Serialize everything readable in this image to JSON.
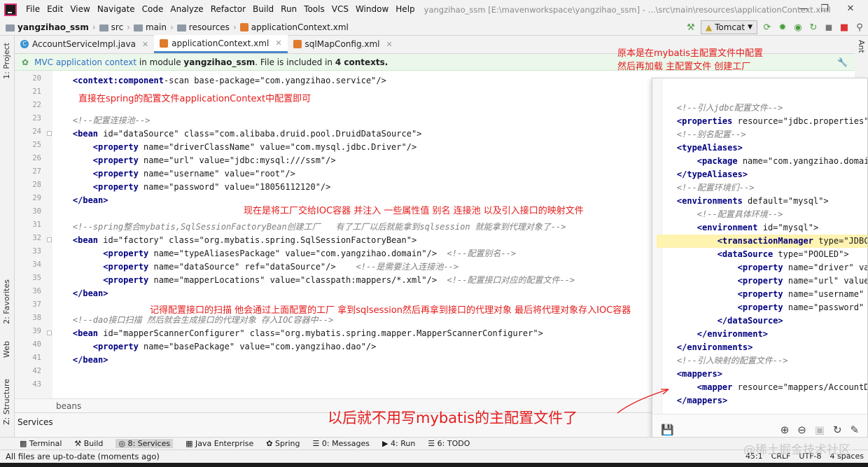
{
  "menubar": {
    "items": [
      "File",
      "Edit",
      "View",
      "Navigate",
      "Code",
      "Analyze",
      "Refactor",
      "Build",
      "Run",
      "Tools",
      "VCS",
      "Window",
      "Help"
    ],
    "title": "yangzihao_ssm [E:\\mavenworkspace\\yangzihao_ssm] - ...\\src\\main\\resources\\applicationContext.xml"
  },
  "breadcrumb": [
    "yangzihao_ssm",
    "src",
    "main",
    "resources",
    "applicationContext.xml"
  ],
  "toolbar": {
    "run_config": "Tomcat"
  },
  "tabs": [
    {
      "label": "AccountServiceImpl.java",
      "type": "java"
    },
    {
      "label": "applicationContext.xml",
      "type": "xml"
    },
    {
      "label": "sqlMapConfig.xml",
      "type": "xml"
    }
  ],
  "banner": {
    "link": "MVC application context",
    "text1": " in module ",
    "module": "yangzihao_ssm",
    "text2": ". File is included in ",
    "contexts": "4 contexts."
  },
  "side_tabs": {
    "project": "1: Project",
    "favorites": "2: Favorites",
    "web": "Web",
    "structure": "Z: Structure",
    "ant": "Ant"
  },
  "line_numbers": [
    "20",
    "21",
    "22",
    "23",
    "24",
    "25",
    "26",
    "27",
    "28",
    "29",
    "30",
    "31",
    "32",
    "33",
    "34",
    "35",
    "36",
    "37",
    "38",
    "39",
    "40",
    "41",
    "42",
    "43"
  ],
  "code_lines": [
    "    <context:component-scan base-package=\"com.yangzihao.service\"/>",
    "",
    "",
    "    <!--配置连接池-->",
    "    <bean id=\"dataSource\" class=\"com.alibaba.druid.pool.DruidDataSource\">",
    "        <property name=\"driverClassName\" value=\"com.mysql.jdbc.Driver\"/>",
    "        <property name=\"url\" value=\"jdbc:mysql:///ssm\"/>",
    "        <property name=\"username\" value=\"root\"/>",
    "        <property name=\"password\" value=\"18056112120\"/>",
    "    </bean>",
    "",
    "    <!--spring整合mybatis,SqlSessionFactoryBean创建工厂   有了工厂以后就能拿到sqlsession 就能拿到代理对象了-->",
    "    <bean id=\"factory\" class=\"org.mybatis.spring.SqlSessionFactoryBean\">",
    "          <property name=\"typeAliasesPackage\" value=\"com.yangzihao.domain\"/>  <!--配置别名-->",
    "          <property name=\"dataSource\" ref=\"dataSource\"/>    <!--是需要注入连接池-->",
    "          <property name=\"mapperLocations\" value=\"classpath:mappers/*.xml\"/>  <!--配置接口对应的配置文件-->",
    "    </bean>",
    "",
    "    <!--dao接口扫描 然后就会生成接口的代理对象 存入IOC容器中-->",
    "    <bean id=\"mapperScannerConfigurer\" class=\"org.mybatis.spring.mapper.MapperScannerConfigurer\">",
    "        <property name=\"basePackage\" value=\"com.yangzihao.dao\"/>",
    "    </bean>",
    "",
    ""
  ],
  "annotations": {
    "a1": "直接在spring的配置文件applicationContext中配置即可",
    "a2": "现在是将工厂交给IOC容器 并注入 一些属性值  别名  连接池  以及引入接口的映射文件",
    "a3": "记得配置接口的扫描  他会通过上面配置的工厂 拿到sqlsession然后再拿到接口的代理对象 最后将代理对象存入IOC容器",
    "a4": "原本是在mybatis主配置文件中配置",
    "a5": "然后再加载 主配置文件 创建工厂",
    "a6": "以后就不用写mybatis的主配置文件了"
  },
  "popup_lines": [
    "    <!--引入jdbc配置文件-->",
    "    <properties resource=\"jdbc.properties\"/>",
    "    <!--别名配置-->",
    "    <typeAliases>",
    "        <package name=\"com.yangzihao.domain\"/>",
    "    </typeAliases>",
    "    <!--配置环境们-->",
    "    <environments default=\"mysql\">",
    "        <!--配置具体环境-->",
    "        <environment id=\"mysql\">",
    "            <transactionManager type=\"JDBC\"></tr",
    "            <dataSource type=\"POOLED\">",
    "                <property name=\"driver\" value=\"$",
    "                <property name=\"url\" value=\"${j",
    "                <property name=\"username\" value",
    "                <property name=\"password\" value",
    "            </dataSource>",
    "        </environment>",
    "    </environments>",
    "    <!--引入映射的配置文件-->",
    "    <mappers>",
    "        <mapper resource=\"mappers/AccountDao.xm",
    "    </mappers>"
  ],
  "editor_breadcrumb": "beans",
  "services_label": "Services",
  "bottom_tabs": [
    "Terminal",
    "Build",
    "8: Services",
    "Java Enterprise",
    "Spring",
    "0: Messages",
    "4: Run",
    "6: TODO"
  ],
  "status": {
    "message": "All files are up-to-date (moments ago)",
    "position": "45:1",
    "line_sep": "CRLF",
    "encoding": "UTF-8",
    "indent": "4 spaces"
  },
  "watermark": "@稀土掘金技术社区"
}
